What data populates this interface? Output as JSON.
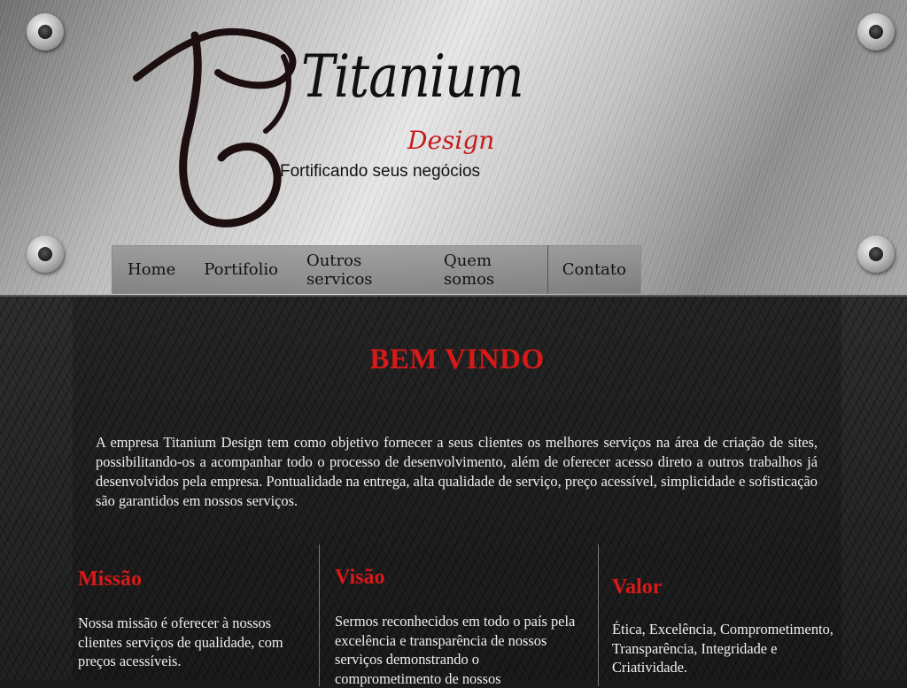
{
  "brand": {
    "title": "Titanium",
    "subtitle": "Design",
    "tagline": "Fortificando seus negócios"
  },
  "nav": {
    "items": [
      {
        "label": "Home"
      },
      {
        "label": "Portifolio"
      },
      {
        "label": "Outros servicos"
      },
      {
        "label": "Quem somos"
      },
      {
        "label": "Contato"
      }
    ]
  },
  "main": {
    "welcome": "BEM VINDO",
    "intro": "A empresa Titanium Design tem como objetivo fornecer a seus clientes os melhores serviços na área de criação de sites, possibilitando-os a acompanhar todo o processo de desenvolvimento, além de oferecer acesso direto a outros trabalhos já desenvolvidos pela empresa. Pontualidade na entrega, alta qualidade de serviço, preço acessível, simplicidade e sofisticação são garantidos em nossos serviços.",
    "columns": [
      {
        "title": "Missão",
        "text": "Nossa missão é oferecer à nossos clientes serviços de qualidade, com preços acessíveis."
      },
      {
        "title": "Visão",
        "text": "Sermos reconhecidos em todo o país pela excelência e transparência de nossos serviços demonstrando o comprometimento de nossos"
      },
      {
        "title": "Valor",
        "text": "Ética, Excelência, Comprometimento, Transparência, Integridade e Criatividade."
      }
    ]
  },
  "colors": {
    "accent_red": "#d81919",
    "logo_red": "#c41b1b"
  }
}
